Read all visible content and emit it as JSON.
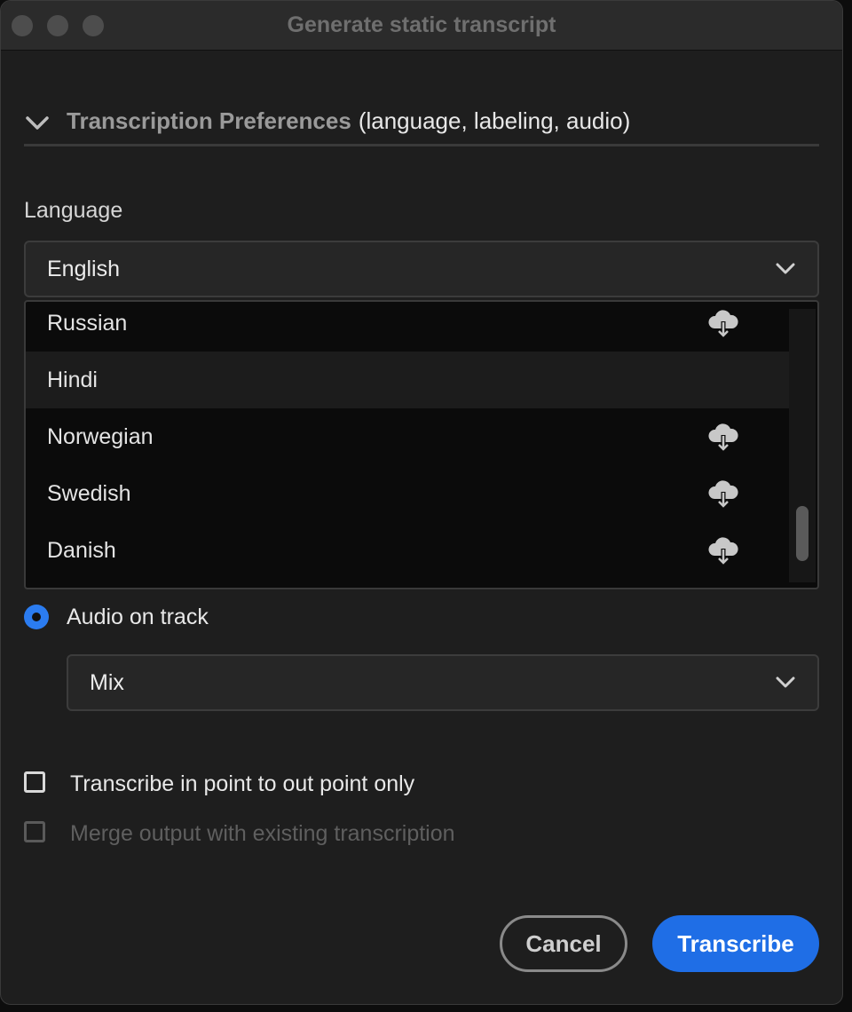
{
  "window": {
    "title": "Generate static transcript"
  },
  "section": {
    "title": "Transcription Preferences",
    "subtitle": "(language, labeling, audio)"
  },
  "language": {
    "label": "Language",
    "selected": "English",
    "options": [
      {
        "label": "Russian",
        "download_icon": "cloud-download-icon"
      },
      {
        "label": "Hindi",
        "download_icon": null,
        "hovered": true
      },
      {
        "label": "Norwegian",
        "download_icon": "cloud-download-icon"
      },
      {
        "label": "Swedish",
        "download_icon": "cloud-download-icon"
      },
      {
        "label": "Danish",
        "download_icon": "cloud-download-icon"
      }
    ]
  },
  "audio": {
    "radio_label": "Audio on track",
    "radio_selected": true,
    "track_selected": "Mix"
  },
  "options": {
    "in_out_label": "Transcribe in point to out point only",
    "in_out_checked": false,
    "merge_label": "Merge output with existing transcription",
    "merge_checked": false,
    "merge_disabled": true
  },
  "buttons": {
    "cancel": "Cancel",
    "transcribe": "Transcribe"
  },
  "colors": {
    "accent": "#1f6ee6",
    "radio": "#2b7cf0",
    "background": "#1e1e1e",
    "list_background": "#0b0b0b"
  }
}
